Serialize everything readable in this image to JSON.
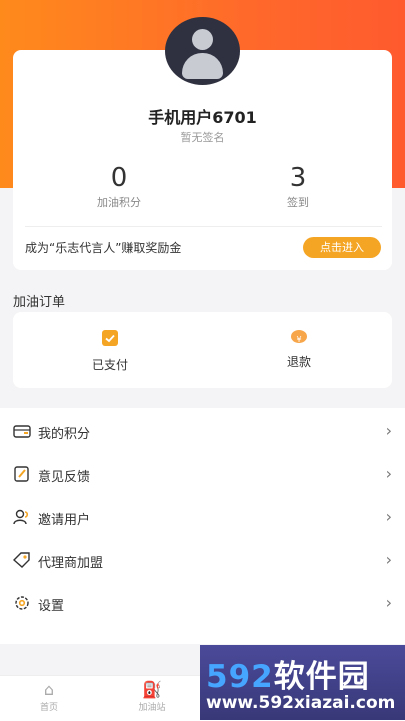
{
  "profile": {
    "username": "手机用户6701",
    "signature": "暂无签名",
    "points_value": "0",
    "points_label": "加油积分",
    "checkin_value": "3",
    "checkin_label": "签到",
    "promo_text": "成为“乐志代言人”赚取奖励金",
    "enter_button": "点击进入"
  },
  "orders": {
    "title": "加油订单",
    "items": [
      {
        "label": "已支付",
        "icon": "clipboard-check-icon"
      },
      {
        "label": "退款",
        "icon": "refund-icon"
      }
    ]
  },
  "menu": [
    {
      "label": "我的积分",
      "icon": "wallet-icon"
    },
    {
      "label": "意见反馈",
      "icon": "edit-note-icon"
    },
    {
      "label": "邀请用户",
      "icon": "user-invite-icon"
    },
    {
      "label": "代理商加盟",
      "icon": "tag-icon"
    },
    {
      "label": "设置",
      "icon": "gear-icon"
    }
  ],
  "tabs": [
    {
      "label": "首页",
      "icon": "home-icon"
    },
    {
      "label": "加油站",
      "icon": "gas-pump-icon"
    }
  ],
  "watermark": {
    "logo_num": "592",
    "logo_text": "软件园",
    "url": "www.592xiazai.com"
  },
  "colors": {
    "accent": "#ff7a22",
    "button": "#f5a524"
  }
}
